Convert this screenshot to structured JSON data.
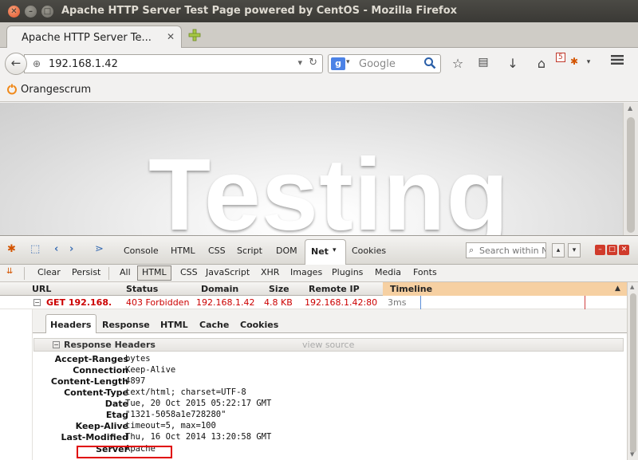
{
  "window": {
    "title": "Apache HTTP Server Test Page powered by CentOS - Mozilla Firefox",
    "close_glyph": "✕",
    "minimize_glyph": "–",
    "maximize_glyph": "□"
  },
  "tab": {
    "title": "Apache HTTP Server Te...",
    "close_glyph": "✕"
  },
  "navbar": {
    "url": "192.168.1.42",
    "search_engine_letter": "g",
    "search_placeholder": "Google",
    "badge_count": "5"
  },
  "bookmarks": [
    {
      "label": "Orangescrum"
    }
  ],
  "page": {
    "hero_text": "Testing"
  },
  "firebug": {
    "panel_tabs": [
      "Console",
      "HTML",
      "CSS",
      "Script",
      "DOM",
      "Net",
      "Cookies"
    ],
    "active_panel": "Net",
    "search_placeholder": "Search within Ne",
    "toolbar": {
      "clear": "Clear",
      "persist": "Persist",
      "filters": [
        "All",
        "HTML",
        "CSS",
        "JavaScript",
        "XHR",
        "Images",
        "Plugins",
        "Media",
        "Fonts"
      ],
      "active_filter": "HTML"
    },
    "net_columns": [
      "URL",
      "Status",
      "Domain",
      "Size",
      "Remote IP",
      "Timeline"
    ],
    "request": {
      "url": "GET 192.168.",
      "status": "403 Forbidden",
      "domain": "192.168.1.42",
      "size": "4.8 KB",
      "remote_ip": "192.168.1.42:80",
      "time": "3ms"
    },
    "detail_tabs": [
      "Headers",
      "Response",
      "HTML",
      "Cache",
      "Cookies"
    ],
    "active_detail_tab": "Headers",
    "response_headers": {
      "title": "Response Headers",
      "view_source": "view source",
      "rows": [
        {
          "name": "Accept-Ranges",
          "value": "bytes"
        },
        {
          "name": "Connection",
          "value": "Keep-Alive"
        },
        {
          "name": "Content-Length",
          "value": "4897"
        },
        {
          "name": "Content-Type",
          "value": "text/html; charset=UTF-8"
        },
        {
          "name": "Date",
          "value": "Tue, 20 Oct 2015 05:22:17 GMT"
        },
        {
          "name": "Etag",
          "value": "\"1321-5058a1e728280\""
        },
        {
          "name": "Keep-Alive",
          "value": "timeout=5, max=100"
        },
        {
          "name": "Last-Modified",
          "value": "Thu, 16 Oct 2014 13:20:58 GMT"
        },
        {
          "name": "Server",
          "value": "Apache"
        }
      ]
    }
  },
  "colors": {
    "error_red": "#cc0000",
    "highlight_box": "#e00000",
    "timeline_header": "#f6d0a2"
  }
}
